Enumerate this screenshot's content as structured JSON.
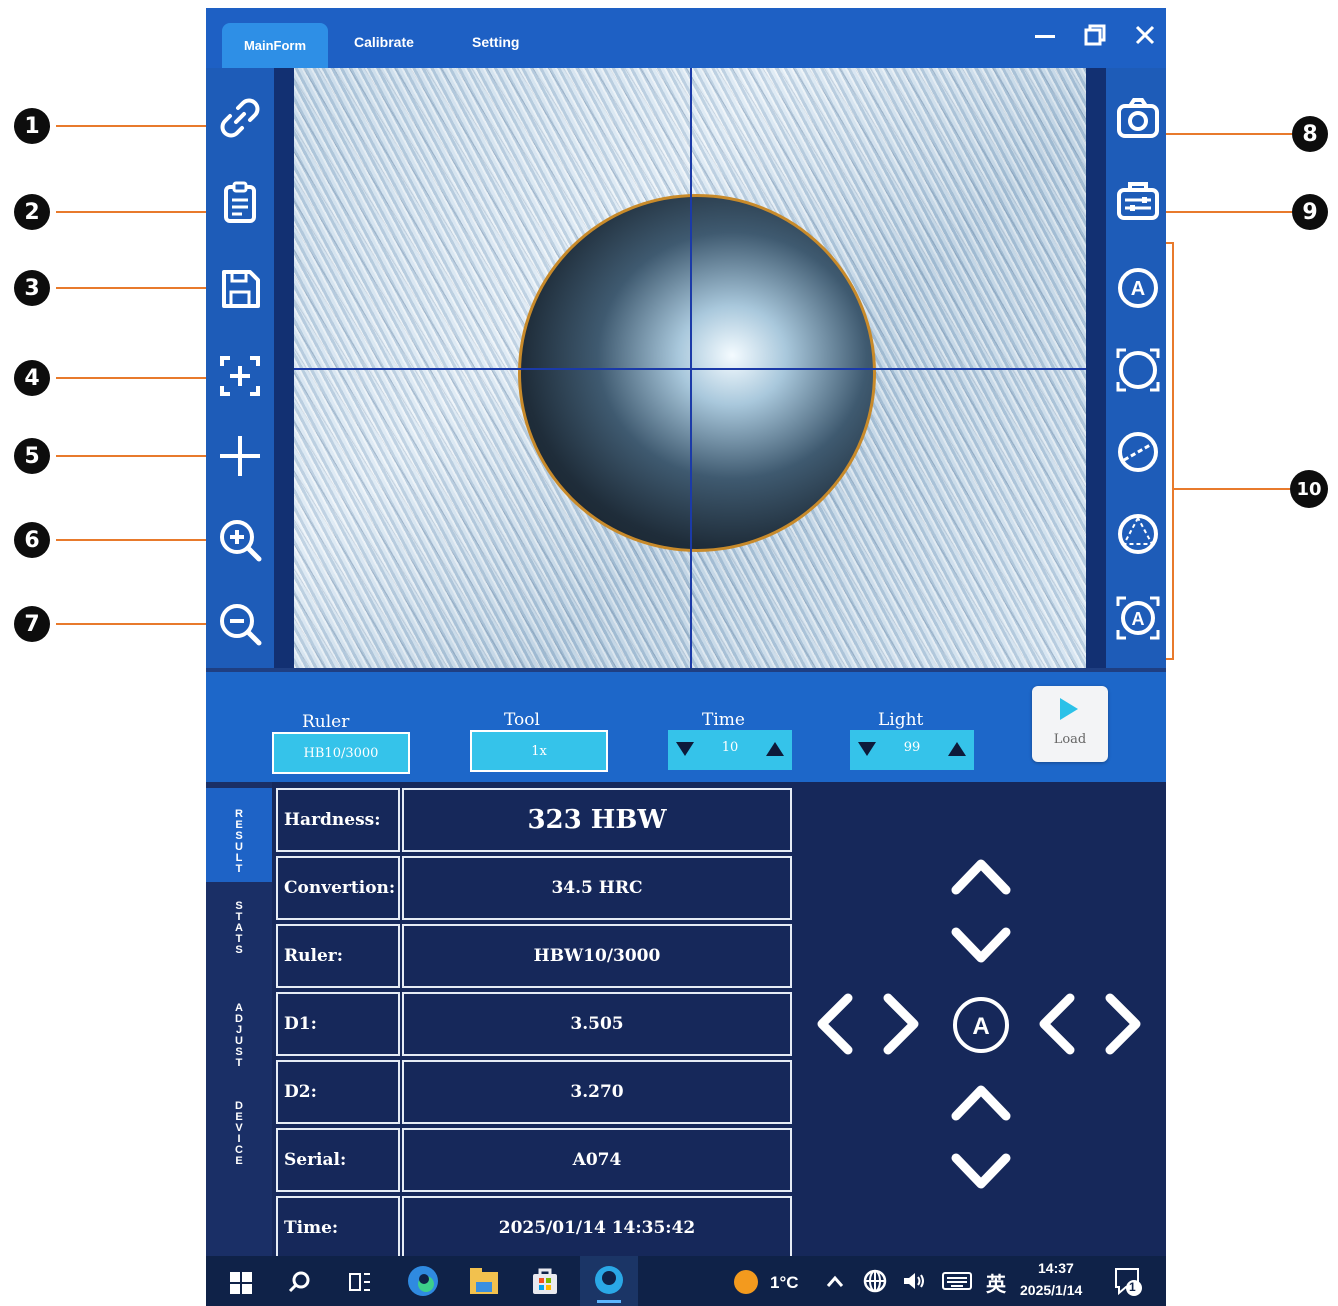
{
  "tabs": [
    "MainForm",
    "Calibrate",
    "Setting"
  ],
  "callouts": [
    "1",
    "2",
    "3",
    "4",
    "5",
    "6",
    "7",
    "8",
    "9",
    "10"
  ],
  "left_toolbar": [
    "link-icon",
    "clipboard-icon",
    "save-icon",
    "focus-icon",
    "crosshair-icon",
    "zoom-in-icon",
    "zoom-out-icon"
  ],
  "right_toolbar": [
    "camera-icon",
    "settings-panel-icon",
    "auto-measure-icon",
    "circle-measure-icon",
    "diameter-icon",
    "three-point-icon",
    "auto-frame-icon"
  ],
  "controls": {
    "ruler": {
      "label": "Ruler",
      "value": "HB10/3000"
    },
    "tool": {
      "label": "Tool",
      "value": "1x"
    },
    "time": {
      "label": "Time",
      "value": "10"
    },
    "light": {
      "label": "Light",
      "value": "99"
    },
    "load": {
      "label": "Load"
    }
  },
  "side_tabs": [
    "RESULT",
    "STATS",
    "ADJUST",
    "DEVICE"
  ],
  "results": [
    {
      "key": "Hardness:",
      "value": "323  HBW"
    },
    {
      "key": "Convertion:",
      "value": "34.5 HRC"
    },
    {
      "key": "Ruler:",
      "value": "HBW10/3000"
    },
    {
      "key": "D1:",
      "value": "3.505"
    },
    {
      "key": "D2:",
      "value": "3.270"
    },
    {
      "key": "Serial:",
      "value": "A074"
    },
    {
      "key": "Time:",
      "value": "2025/01/14 14:35:42"
    }
  ],
  "nav": {
    "center": "A"
  },
  "taskbar": {
    "weather": "1°C",
    "ime": "英",
    "time": "14:37",
    "date": "2025/1/14",
    "notifications": "1"
  },
  "colors": {
    "accent": "#1e60c4",
    "panel": "#16285a",
    "callout_line": "#e87a2c",
    "field": "#35c3ea"
  }
}
